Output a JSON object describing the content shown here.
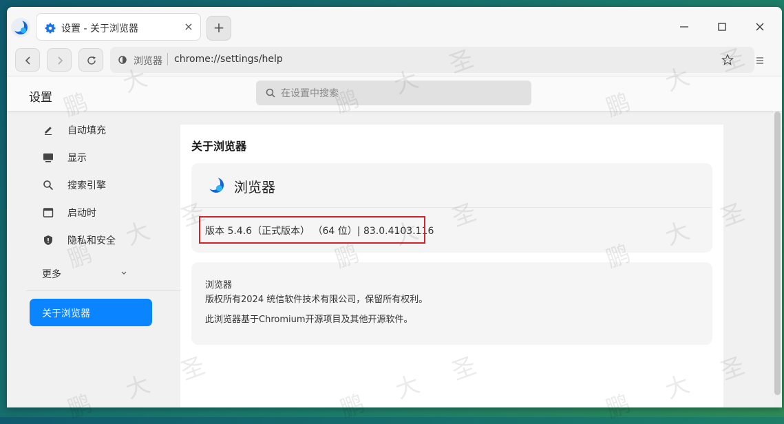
{
  "tab": {
    "title": "设置 - 关于浏览器",
    "close_glyph": "×"
  },
  "new_tab_glyph": "+",
  "address": {
    "site_label": "浏览器",
    "url": "chrome://settings/help"
  },
  "header": {
    "title": "设置",
    "search_placeholder": "在设置中搜索"
  },
  "sidebar": {
    "items": [
      {
        "label": "自动填充",
        "icon": "pencil-icon"
      },
      {
        "label": "显示",
        "icon": "monitor-icon"
      },
      {
        "label": "搜索引擎",
        "icon": "search-icon"
      },
      {
        "label": "启动时",
        "icon": "window-icon"
      },
      {
        "label": "隐私和安全",
        "icon": "shield-icon"
      }
    ],
    "more_label": "更多",
    "active_item": "关于浏览器"
  },
  "about": {
    "section_title": "关于浏览器",
    "app_name": "浏览器",
    "version": "版本 5.4.6（正式版本） （64 位）| 83.0.4103.116",
    "copyright_name": "浏览器",
    "copyright_line": "版权所有2024 统信软件技术有限公司，保留所有权利。",
    "chromium_line": "此浏览器基于Chromium开源项目及其他开源软件。"
  },
  "watermark_chars": [
    "鹏",
    "大",
    "圣"
  ],
  "colors": {
    "accent": "#0a84ff",
    "highlight_border": "#d3232a"
  }
}
